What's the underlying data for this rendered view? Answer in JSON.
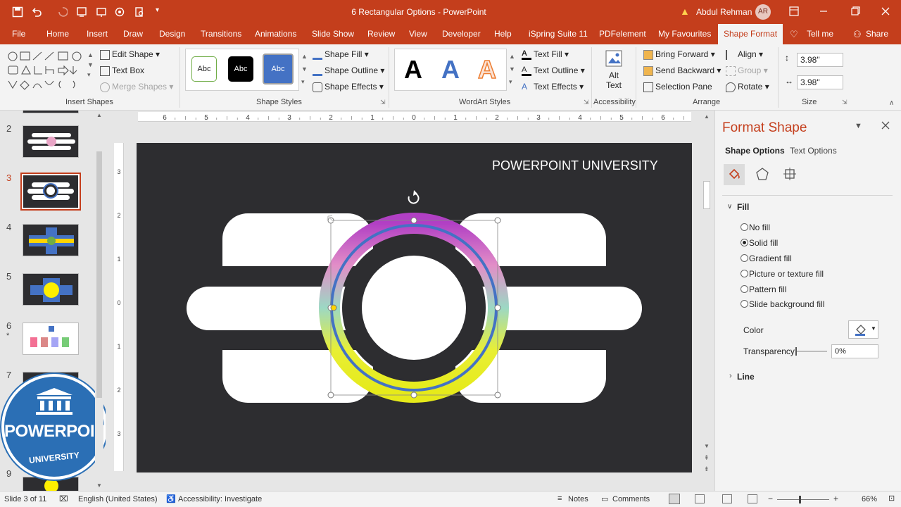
{
  "window": {
    "title": "6 Rectangular Options  -  PowerPoint",
    "user": "Abdul Rehman",
    "initials": "AR",
    "warning_icon": "warning-icon"
  },
  "tabs": [
    {
      "label": "File"
    },
    {
      "label": "Home"
    },
    {
      "label": "Insert"
    },
    {
      "label": "Draw"
    },
    {
      "label": "Design"
    },
    {
      "label": "Transitions"
    },
    {
      "label": "Animations"
    },
    {
      "label": "Slide Show"
    },
    {
      "label": "Review"
    },
    {
      "label": "View"
    },
    {
      "label": "Developer"
    },
    {
      "label": "Help"
    },
    {
      "label": "iSpring Suite 11"
    },
    {
      "label": "PDFelement"
    },
    {
      "label": "My Favourites"
    },
    {
      "label": "Shape Format"
    }
  ],
  "tellme": "Tell me",
  "share": "Share",
  "ribbon": {
    "insert_shapes": {
      "label": "Insert Shapes",
      "edit_shape": "Edit Shape",
      "text_box": "Text Box",
      "merge_shapes": "Merge Shapes"
    },
    "shape_styles": {
      "label": "Shape Styles",
      "swatches": [
        "Abc",
        "Abc",
        "Abc"
      ],
      "fill": "Shape Fill",
      "outline": "Shape Outline",
      "effects": "Shape Effects"
    },
    "wordart": {
      "label": "WordArt Styles",
      "letters": [
        "A",
        "A",
        "A"
      ],
      "text_fill": "Text Fill",
      "text_outline": "Text Outline",
      "text_effects": "Text Effects"
    },
    "accessibility": {
      "label": "Accessibility",
      "alt_text_1": "Alt",
      "alt_text_2": "Text"
    },
    "arrange": {
      "label": "Arrange",
      "bring_forward": "Bring Forward",
      "send_backward": "Send Backward",
      "selection_pane": "Selection Pane",
      "align": "Align",
      "group": "Group",
      "rotate": "Rotate"
    },
    "size": {
      "label": "Size",
      "height": "3.98\"",
      "width": "3.98\""
    }
  },
  "ruler": {
    "labels": [
      "6",
      "5",
      "4",
      "3",
      "2",
      "1",
      "0",
      "1",
      "2",
      "3",
      "4",
      "5",
      "6"
    ]
  },
  "vruler": {
    "labels": [
      "3",
      "2",
      "1",
      "0",
      "1",
      "2",
      "3"
    ]
  },
  "slides": [
    {
      "num": "2"
    },
    {
      "num": "3"
    },
    {
      "num": "4"
    },
    {
      "num": "5"
    },
    {
      "num": "6"
    },
    {
      "num": "7"
    },
    {
      "num": "9"
    }
  ],
  "slide6_star": "*",
  "slide": {
    "heading": "POWERPOINT UNIVERSITY"
  },
  "watermark": {
    "line1": "POWERPOINT",
    "line2": "UNIVERSITY"
  },
  "format_pane": {
    "title": "Format Shape",
    "tab_shape": "Shape Options",
    "tab_text": "Text Options",
    "section_fill": "Fill",
    "options": [
      "No fill",
      "Solid fill",
      "Gradient fill",
      "Picture or texture fill",
      "Pattern fill",
      "Slide background fill"
    ],
    "selected_option": "Solid fill",
    "color_label": "Color",
    "transparency_label": "Transparency",
    "transparency_value": "0%",
    "section_line": "Line"
  },
  "status": {
    "slide": "Slide 3 of 11",
    "language": "English (United States)",
    "accessibility": "Accessibility: Investigate",
    "notes": "Notes",
    "comments": "Comments",
    "zoom": "66%"
  },
  "colors": {
    "accent": "#c43e1c",
    "slide_bg": "#2d2d30",
    "ring_blue": "#4472c4"
  }
}
